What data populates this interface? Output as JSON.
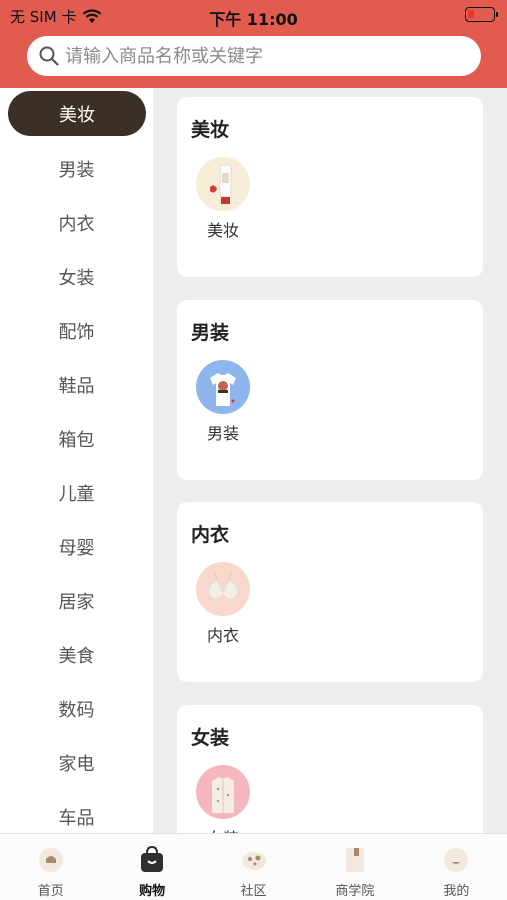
{
  "status_bar": {
    "carrier": "无 SIM 卡",
    "time": "下午 11:00"
  },
  "search": {
    "placeholder": "请输入商品名称或关键字"
  },
  "sidebar": {
    "items": [
      {
        "label": "美妆",
        "active": true
      },
      {
        "label": "男装"
      },
      {
        "label": "内衣"
      },
      {
        "label": "女装"
      },
      {
        "label": "配饰"
      },
      {
        "label": "鞋品"
      },
      {
        "label": "箱包"
      },
      {
        "label": "儿童"
      },
      {
        "label": "母婴"
      },
      {
        "label": "居家"
      },
      {
        "label": "美食"
      },
      {
        "label": "数码"
      },
      {
        "label": "家电"
      },
      {
        "label": "车品"
      }
    ]
  },
  "sections": [
    {
      "title": "美妆",
      "items": [
        {
          "label": "美妆",
          "icon": "cosmetics-tube-icon"
        }
      ]
    },
    {
      "title": "男装",
      "items": [
        {
          "label": "男装",
          "icon": "tshirt-icon"
        }
      ]
    },
    {
      "title": "内衣",
      "items": [
        {
          "label": "内衣",
          "icon": "bra-icon"
        }
      ]
    },
    {
      "title": "女装",
      "items": [
        {
          "label": "女装",
          "icon": "shirt-icon"
        }
      ]
    }
  ],
  "tabbar": {
    "items": [
      {
        "label": "首页",
        "icon": "home-icon"
      },
      {
        "label": "购物",
        "icon": "shopping-bag-icon",
        "active": true
      },
      {
        "label": "社区",
        "icon": "community-icon"
      },
      {
        "label": "商学院",
        "icon": "book-icon"
      },
      {
        "label": "我的",
        "icon": "profile-icon"
      }
    ]
  },
  "colors": {
    "header": "#e15c4f",
    "active_sidebar": "#3a3028"
  }
}
